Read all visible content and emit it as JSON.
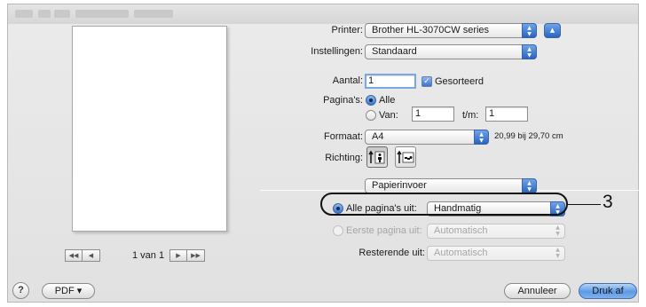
{
  "print": {
    "printer_label": "Printer:",
    "printer_value": "Brother HL-3070CW series",
    "settings_label": "Instellingen:",
    "settings_value": "Standaard",
    "copies_label": "Aantal:",
    "copies_value": "1",
    "collated_label": "Gesorteerd",
    "pages_label": "Pagina's:",
    "pages_all": "Alle",
    "pages_from_label": "Van:",
    "pages_from_value": "1",
    "pages_to_label": "t/m:",
    "pages_to_value": "1",
    "size_label": "Formaat:",
    "size_value": "A4",
    "size_dims": "20,99 bij 29,70 cm",
    "orientation_label": "Richting:",
    "panel_value": "Papierinvoer",
    "all_pages_from_label": "Alle pagina's uit:",
    "all_pages_from_value": "Handmatig",
    "first_page_from_label": "Eerste pagina uit:",
    "first_page_from_value": "Automatisch",
    "remaining_from_label": "Resterende uit:",
    "remaining_from_value": "Automatisch"
  },
  "preview": {
    "page_indicator": "1 van 1"
  },
  "footer": {
    "help_label": "?",
    "pdf_label": "PDF ▾",
    "cancel_label": "Annuleer",
    "print_label": "Druk af"
  },
  "annotation": {
    "callout_number": "3"
  },
  "icons": {
    "popup_arrows": "updown-chevrons-icon",
    "disclosure": "triangle-up-icon",
    "orientation_portrait": "portrait-person-icon",
    "orientation_landscape": "landscape-person-icon",
    "pager_first": "double-left-arrow-icon",
    "pager_prev": "left-arrow-icon",
    "pager_next": "right-arrow-icon",
    "pager_last": "double-right-arrow-icon"
  },
  "colors": {
    "accent": "#3a74cf",
    "dialog_bg": "#e6e6e6",
    "callout": "#111111"
  }
}
